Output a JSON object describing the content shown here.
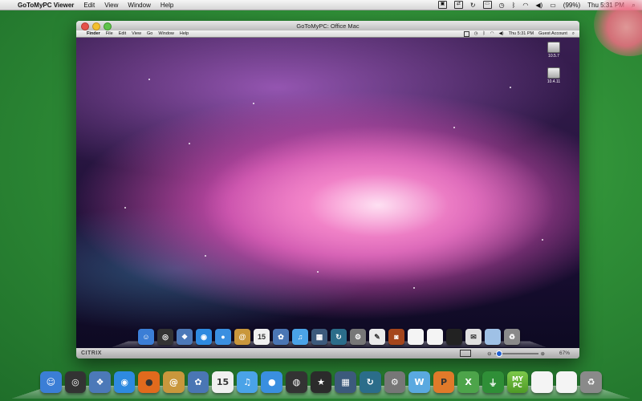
{
  "host_menubar": {
    "apple": "",
    "app_name": "GoToMyPC Viewer",
    "menus": [
      "Edit",
      "View",
      "Window",
      "Help"
    ],
    "battery": "(99%)",
    "clock": "Thu 5:31 PM"
  },
  "window": {
    "title": "GoToMyPC: Office Mac",
    "remote_menubar": {
      "apple": "",
      "app_name": "Finder",
      "menus": [
        "File",
        "Edit",
        "View",
        "Go",
        "Window",
        "Help"
      ],
      "clock": "Thu 5:31 PM",
      "user": "Guest Account"
    },
    "desktop_drives": [
      {
        "label": "10.5.7"
      },
      {
        "label": "10.4.11"
      }
    ],
    "statusbar": {
      "brand": "CITRIX",
      "zoom": "67%",
      "zoom_fraction": 0.05
    }
  },
  "remote_dock": [
    {
      "name": "finder",
      "glyph": "☺",
      "color": "#3b7ed6"
    },
    {
      "name": "dashboard",
      "glyph": "◎",
      "color": "#333"
    },
    {
      "name": "preview",
      "glyph": "❖",
      "color": "#4c79b8"
    },
    {
      "name": "safari",
      "glyph": "◉",
      "color": "#2e8ae0"
    },
    {
      "name": "ichat",
      "glyph": "●",
      "color": "#3a8fe0"
    },
    {
      "name": "addressbook",
      "glyph": "@",
      "color": "#c9973c"
    },
    {
      "name": "ical",
      "glyph": "15",
      "color": "#f0f0f0"
    },
    {
      "name": "iphoto",
      "glyph": "✿",
      "color": "#4a76b4"
    },
    {
      "name": "itunes",
      "glyph": "♫",
      "color": "#4aa3e8"
    },
    {
      "name": "spaces",
      "glyph": "▦",
      "color": "#3c5a7c"
    },
    {
      "name": "timemachine",
      "glyph": "↻",
      "color": "#2b6d8a"
    },
    {
      "name": "systemprefs",
      "glyph": "⚙",
      "color": "#777"
    },
    {
      "name": "textedit",
      "glyph": "✎",
      "color": "#eaeaea"
    },
    {
      "name": "photobooth",
      "glyph": "◙",
      "color": "#a5461c"
    },
    {
      "name": "doc1",
      "glyph": "",
      "color": "#f4f4f4"
    },
    {
      "name": "doc2",
      "glyph": "",
      "color": "#f4f4f4"
    },
    {
      "name": "screen",
      "glyph": "",
      "color": "#222"
    },
    {
      "name": "mail",
      "glyph": "✉",
      "color": "#e0e0e0"
    },
    {
      "name": "folder",
      "glyph": "",
      "color": "#9fc1e6"
    },
    {
      "name": "trash",
      "glyph": "♻",
      "color": "#8a8a8a"
    }
  ],
  "host_dock": [
    {
      "name": "finder",
      "glyph": "☺",
      "color": "#3b7ed6"
    },
    {
      "name": "dashboard",
      "glyph": "◎",
      "color": "#333"
    },
    {
      "name": "preview",
      "glyph": "❖",
      "color": "#4c79b8"
    },
    {
      "name": "safari",
      "glyph": "◉",
      "color": "#2e8ae0"
    },
    {
      "name": "firefox",
      "glyph": "●",
      "color": "#e06a1d"
    },
    {
      "name": "addressbook",
      "glyph": "@",
      "color": "#c9973c"
    },
    {
      "name": "iphoto",
      "glyph": "✿",
      "color": "#4a76b4"
    },
    {
      "name": "ical",
      "glyph": "15",
      "color": "#f0f0f0"
    },
    {
      "name": "itunes",
      "glyph": "♫",
      "color": "#4aa3e8"
    },
    {
      "name": "ichat",
      "glyph": "●",
      "color": "#3a8fe0"
    },
    {
      "name": "aperture",
      "glyph": "◍",
      "color": "#333"
    },
    {
      "name": "imovie",
      "glyph": "★",
      "color": "#2b2b2b"
    },
    {
      "name": "spaces",
      "glyph": "▦",
      "color": "#3c5a7c"
    },
    {
      "name": "timemachine",
      "glyph": "↻",
      "color": "#2b6d8a"
    },
    {
      "name": "systemprefs",
      "glyph": "⚙",
      "color": "#777"
    },
    {
      "name": "word",
      "glyph": "W",
      "color": "#5aa9e0"
    },
    {
      "name": "powerpoint",
      "glyph": "P",
      "color": "#e07a2a"
    },
    {
      "name": "excel",
      "glyph": "X",
      "color": "#4da44a"
    },
    {
      "name": "gotomypc-connect",
      "glyph": "⏚",
      "color": "#2f8f37"
    },
    {
      "name": "mypc",
      "glyph": "MY PC",
      "color": "#5aa832"
    },
    {
      "name": "doc1",
      "glyph": "",
      "color": "#f4f4f4"
    },
    {
      "name": "doc2",
      "glyph": "",
      "color": "#f4f4f4"
    },
    {
      "name": "trash",
      "glyph": "♻",
      "color": "#8a8a8a"
    }
  ]
}
